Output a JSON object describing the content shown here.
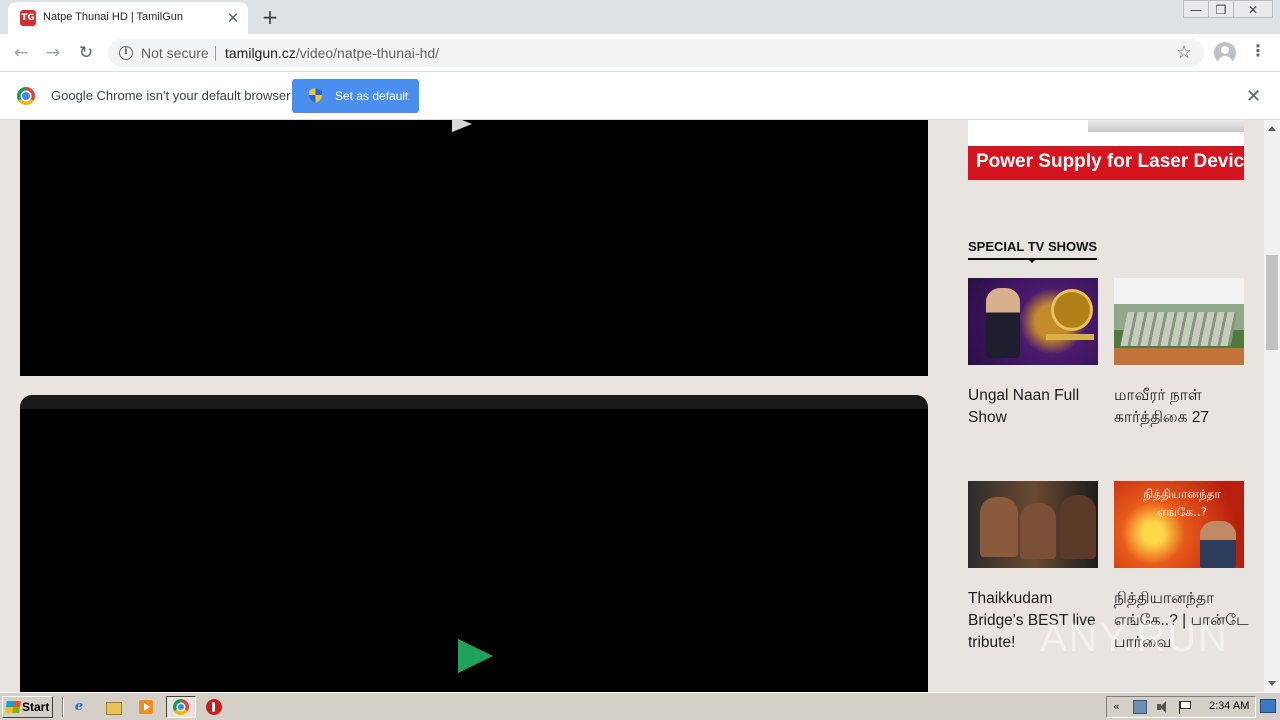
{
  "browser": {
    "tab": {
      "title": "Natpe Thunai HD | TamilGun",
      "favicon_text": "TG",
      "close_glyph": "✕"
    },
    "new_tab_glyph": "+",
    "window_controls": {
      "minimize": "—",
      "restore": "❐",
      "close": "✕"
    },
    "nav": {
      "back": "←",
      "forward": "→",
      "reload": "↻"
    },
    "omnibox": {
      "security_text": "Not secure",
      "url_domain": "tamilgun.cz",
      "url_path": "/video/natpe-thunai-hd/"
    },
    "bookmark_glyph": "☆",
    "menu_glyph": "⋮"
  },
  "infobar": {
    "message": "Google Chrome isn't your default browser",
    "button_label": "Set as default",
    "close_glyph": "✕"
  },
  "page": {
    "ad_text": "Power Supply for Laser Devices",
    "section_title": "SPECIAL TV SHOWS",
    "shows": [
      {
        "title": "Ungal Naan Full Show"
      },
      {
        "title": "மாவீரர் நாள் கார்த்திகை 27"
      },
      {
        "title": "Thaikkudam Bridge's BEST live tribute!"
      },
      {
        "title": "நித்தியானந்தா எங்கே..? | பான்டே பார்வை",
        "thumb_text": "நித்தியானந்தா எங்கே..?"
      }
    ],
    "watermark": "ANY.RUN"
  },
  "taskbar": {
    "start_label": "Start",
    "ie_glyph": "e",
    "tray_chevron": "«",
    "clock": "2:34 AM"
  },
  "colors": {
    "infobar_button": "#4a8ff0",
    "ad_red": "#d4141f",
    "play_green": "#1fa35b"
  },
  "icons": [
    "info-icon",
    "star-icon",
    "profile-icon",
    "menu-icon",
    "chrome-logo-icon",
    "shield-icon",
    "close-icon",
    "play-icon",
    "windows-logo-icon",
    "ie-icon",
    "folder-icon",
    "media-player-icon",
    "chrome-icon",
    "opera-icon",
    "network-icon",
    "volume-icon",
    "flag-icon"
  ]
}
